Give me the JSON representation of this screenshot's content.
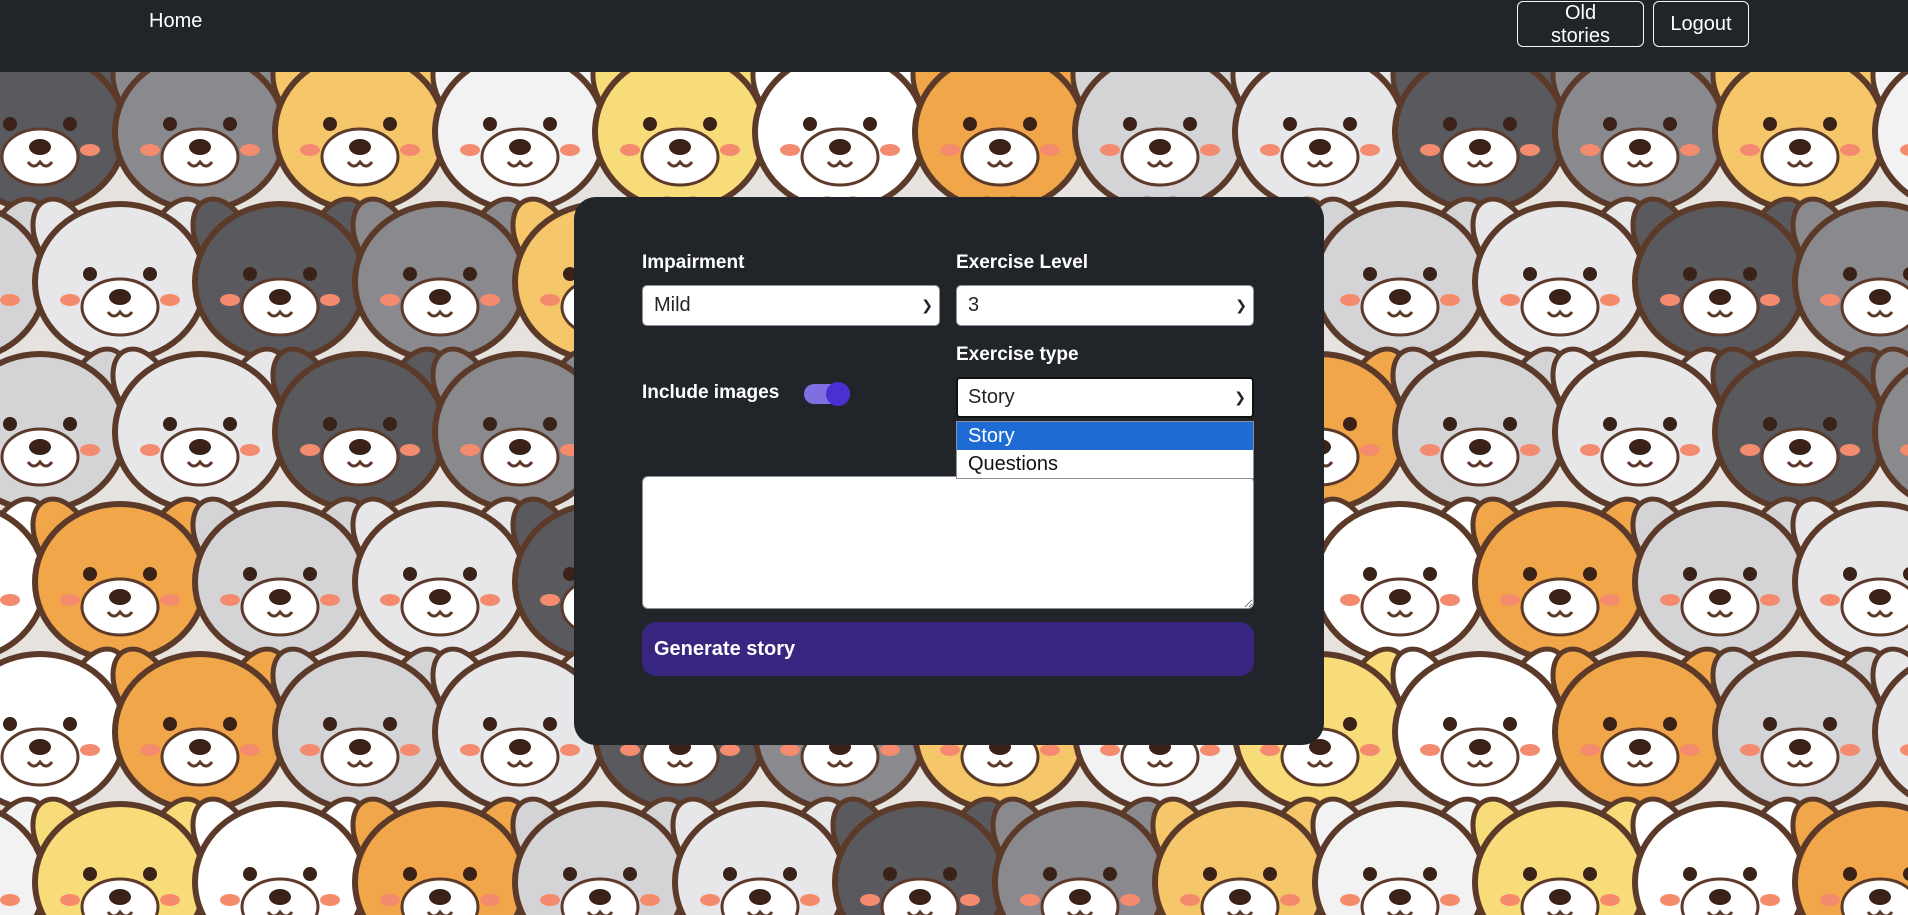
{
  "nav": {
    "home_label": "Home",
    "old_stories_label": "Old stories",
    "logout_label": "Logout"
  },
  "form": {
    "impairment": {
      "label": "Impairment",
      "value": "Mild"
    },
    "exercise_level": {
      "label": "Exercise Level",
      "value": "3"
    },
    "include_images": {
      "label": "Include images",
      "enabled": true
    },
    "exercise_type": {
      "label": "Exercise type",
      "value": "Story",
      "options": [
        "Story",
        "Questions"
      ],
      "dropdown_open": true
    },
    "text_input": {
      "value": ""
    },
    "generate_label": "Generate story"
  },
  "colors": {
    "navbar": "#212529",
    "card": "#212529",
    "accent": "#37257f",
    "toggle_knob": "#4b2fd1",
    "selected_option": "#1f6bd6"
  }
}
